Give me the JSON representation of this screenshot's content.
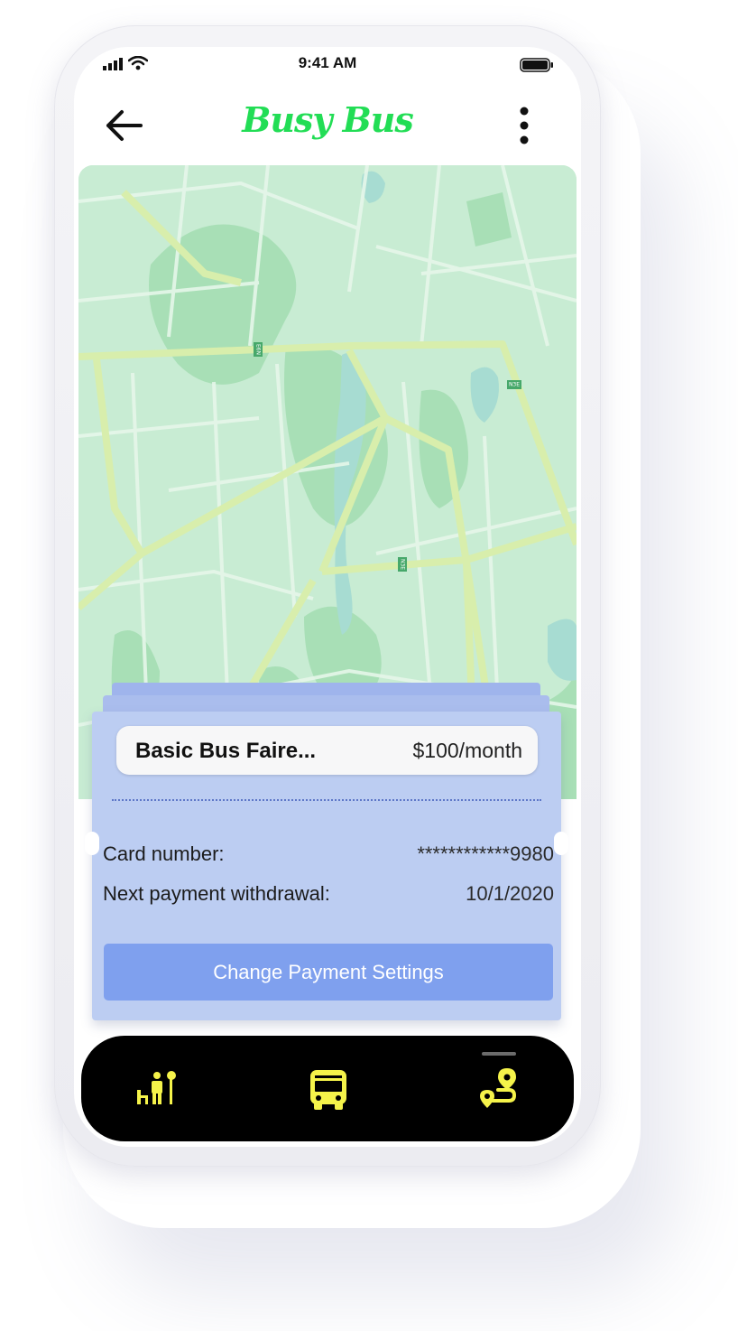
{
  "status_bar": {
    "time": "9:41 AM"
  },
  "header": {
    "app_title": "Busy Bus"
  },
  "plan": {
    "name": "Basic Bus Faire...",
    "price": "$100/month"
  },
  "payment": {
    "card_label": "Card number:",
    "card_value": "************9980",
    "next_label": "Next payment withdrawal:",
    "next_value": "10/1/2020",
    "button_label": "Change Payment Settings"
  },
  "map": {
    "road_labels": [
      "E6N",
      "N3E",
      "N3E"
    ]
  },
  "bottom_nav": {
    "items": [
      {
        "icon": "bus-stop-icon"
      },
      {
        "icon": "bus-icon"
      },
      {
        "icon": "route-icon"
      }
    ]
  },
  "colors": {
    "brand_green": "#22dd55",
    "nav_accent": "#f5f34a",
    "card_bg": "#bccdf2",
    "button_bg": "#7fa0ee",
    "map_bg": "#c8ecd3"
  }
}
